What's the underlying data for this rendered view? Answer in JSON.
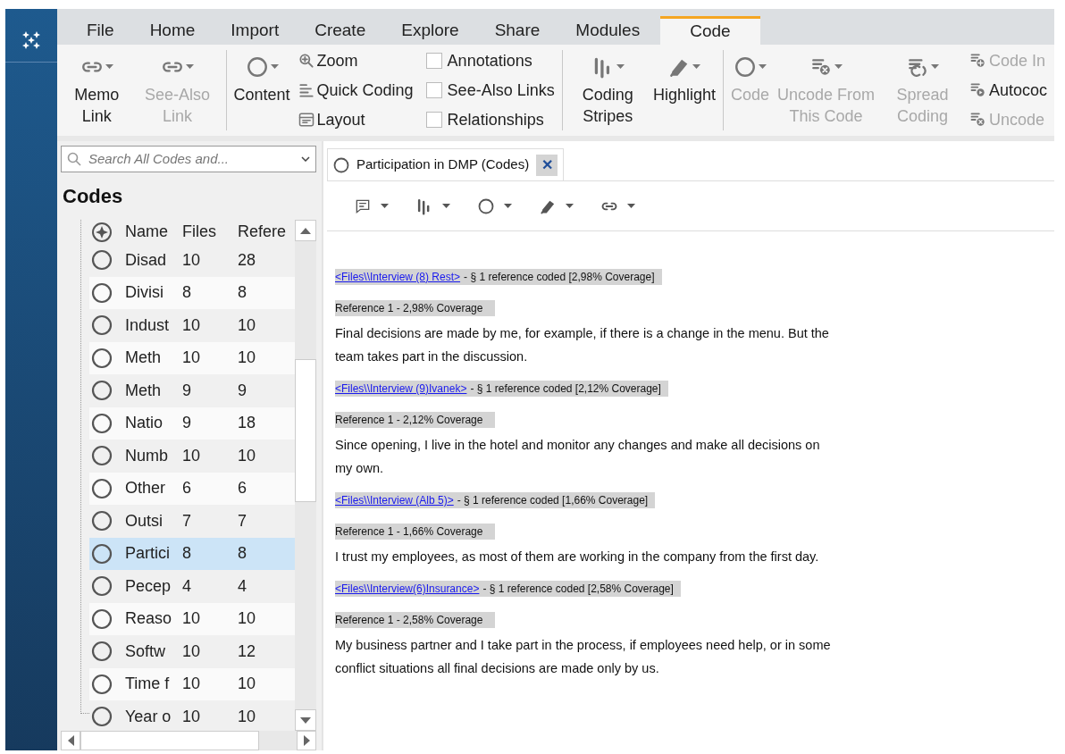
{
  "menu_tabs": [
    {
      "label": "File",
      "selected": false
    },
    {
      "label": "Home",
      "selected": false
    },
    {
      "label": "Import",
      "selected": false
    },
    {
      "label": "Create",
      "selected": false
    },
    {
      "label": "Explore",
      "selected": false
    },
    {
      "label": "Share",
      "selected": false
    },
    {
      "label": "Modules",
      "selected": false
    },
    {
      "label": "Code",
      "selected": true
    }
  ],
  "ribbon": {
    "groups": [
      {
        "columns": [
          {
            "kind": "large",
            "label": "Memo Link",
            "disabled": false
          },
          {
            "kind": "large",
            "label": "See-Also Link",
            "disabled": true
          }
        ]
      },
      {
        "columns": [
          {
            "kind": "large",
            "label": "Content",
            "disabled": false
          },
          {
            "kind": "stack",
            "items": [
              {
                "kind": "small",
                "label": "Zoom",
                "disabled": false
              },
              {
                "kind": "small",
                "label": "Quick Coding",
                "disabled": false
              },
              {
                "kind": "small",
                "label": "Layout",
                "disabled": false
              }
            ]
          },
          {
            "kind": "stack",
            "items": [
              {
                "kind": "check",
                "label": "Annotations",
                "checked": false
              },
              {
                "kind": "check",
                "label": "See-Also Links",
                "checked": false
              },
              {
                "kind": "check",
                "label": "Relationships",
                "checked": false
              }
            ]
          }
        ]
      },
      {
        "columns": [
          {
            "kind": "large",
            "label": "Coding Stripes",
            "disabled": false
          },
          {
            "kind": "large",
            "label": "Highlight",
            "disabled": false
          }
        ]
      },
      {
        "columns": [
          {
            "kind": "large",
            "label": "Code",
            "disabled": true
          },
          {
            "kind": "large",
            "label": "Uncode From This Code",
            "disabled": true
          },
          {
            "kind": "large",
            "label": "Spread Coding",
            "disabled": true
          },
          {
            "kind": "stack",
            "items": [
              {
                "kind": "small",
                "label": "Code In",
                "disabled": true
              },
              {
                "kind": "small",
                "label": "Autococ",
                "disabled": false
              },
              {
                "kind": "small",
                "label": "Uncode",
                "disabled": true
              }
            ]
          }
        ]
      }
    ]
  },
  "search": {
    "placeholder": "Search All Codes and..."
  },
  "codes_panel": {
    "title": "Codes",
    "columns": [
      "Name",
      "Files",
      "Refere"
    ],
    "rows": [
      {
        "name": "Disad",
        "files": "10",
        "references": "28",
        "selected": false
      },
      {
        "name": "Divisi",
        "files": "8",
        "references": "8",
        "selected": false
      },
      {
        "name": "Indust",
        "files": "10",
        "references": "10",
        "selected": false
      },
      {
        "name": "Meth",
        "files": "10",
        "references": "10",
        "selected": false
      },
      {
        "name": "Meth",
        "files": "9",
        "references": "9",
        "selected": false
      },
      {
        "name": "Natio",
        "files": "9",
        "references": "18",
        "selected": false
      },
      {
        "name": "Numb",
        "files": "10",
        "references": "10",
        "selected": false
      },
      {
        "name": "Other",
        "files": "6",
        "references": "6",
        "selected": false
      },
      {
        "name": "Outsi",
        "files": "7",
        "references": "7",
        "selected": false
      },
      {
        "name": "Partici",
        "files": "8",
        "references": "8",
        "selected": true
      },
      {
        "name": "Pecep",
        "files": "4",
        "references": "4",
        "selected": false
      },
      {
        "name": "Reaso",
        "files": "10",
        "references": "10",
        "selected": false
      },
      {
        "name": "Softw",
        "files": "10",
        "references": "12",
        "selected": false
      },
      {
        "name": "Time f",
        "files": "10",
        "references": "10",
        "selected": false
      },
      {
        "name": "Year o",
        "files": "10",
        "references": "10",
        "selected": false
      }
    ]
  },
  "document": {
    "tab": {
      "label": "Participation in DMP (Codes)",
      "close": "✕"
    },
    "entries": [
      {
        "link": "<Files\\\\Interview (8) Rest>",
        "summary": "- § 1 reference coded  [2,98% Coverage]",
        "reference": "Reference 1 - 2,98% Coverage",
        "text": "Final decisions are made by me, for example, if there is a change in the menu. But the team takes part in the discussion."
      },
      {
        "link": "<Files\\\\Interview (9)Ivanek>",
        "summary": "- § 1 reference coded  [2,12% Coverage]",
        "reference": "Reference 1 - 2,12% Coverage",
        "text": "Since opening, I live in the hotel and monitor any changes and make all decisions on my own."
      },
      {
        "link": "<Files\\\\Interview (Alb 5)>",
        "summary": "- § 1 reference coded  [1,66% Coverage]",
        "reference": "Reference 1 - 1,66% Coverage",
        "text": "I trust my employees, as most of them are working in the company from the first day."
      },
      {
        "link": "<Files\\\\Interview(6)Insurance>",
        "summary": "- § 1 reference coded  [2,58% Coverage]",
        "reference": "Reference 1 - 2,58% Coverage",
        "text": "My business partner and I take part in the process, if employees need help, or in some conflict situations all final decisions are made only by us."
      }
    ]
  }
}
